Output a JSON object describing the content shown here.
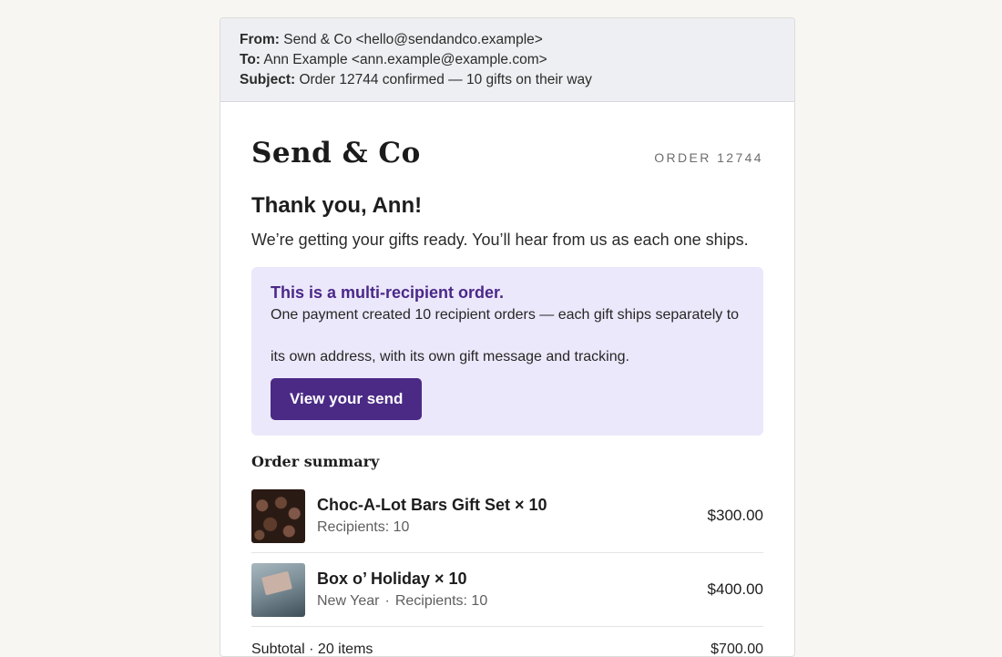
{
  "email": {
    "from_label": "From:",
    "from": "Send & Co <hello@sendandco.example>",
    "to_label": "To:",
    "to": "Ann Example <ann.example@example.com>",
    "subject_label": "Subject:",
    "subject": "Order 12744 confirmed — 10 gifts on their way"
  },
  "brand": "Send & Co",
  "order_number": "ORDER 12744",
  "greeting": "Thank you, Ann!",
  "intro": "We’re getting your gifts ready. You’ll hear from us as each one ships.",
  "callout": {
    "title": "This is a multi-recipient order.",
    "text": "One payment created 10 recipient orders — each gift ships separately to its own address, with its own gift message and tracking.",
    "button": "View your send"
  },
  "summary_title": "Order summary",
  "items": [
    {
      "name": "Choc-A-Lot Bars Gift Set × 10",
      "meta_variant": "",
      "meta_recipients": "Recipients: 10",
      "price": "$300.00",
      "image": "chocolate-image"
    },
    {
      "name": "Box o’ Holiday × 10",
      "meta_variant": "New Year",
      "meta_recipients": "Recipients: 10",
      "price": "$400.00",
      "image": "gift-box-image"
    }
  ],
  "subtotal_label": "Subtotal · 20 items",
  "subtotal_value": "$700.00",
  "colors": {
    "accent": "#4b2a86",
    "callout_bg": "#ece8fb",
    "callout_title": "#4a2889"
  }
}
